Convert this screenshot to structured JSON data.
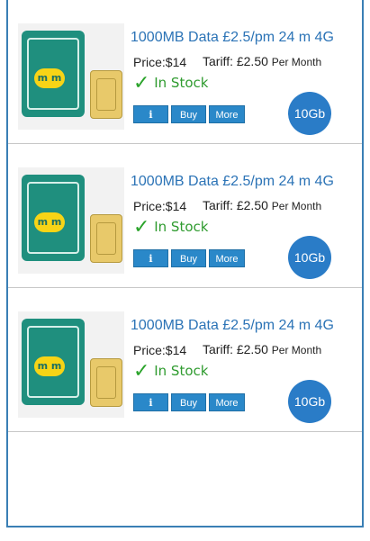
{
  "products": [
    {
      "title": "1000MB Data £2.5/pm 24 m 4G",
      "price": "Price:$14",
      "tariff_label": "Tariff: £2.50",
      "tariff_unit": "Per Month",
      "stock": "In Stock",
      "info_label": "i",
      "buy_label": "Buy",
      "more_label": "More",
      "badge": "10Gb",
      "logo_text": "m m"
    },
    {
      "title": "1000MB Data £2.5/pm 24 m 4G",
      "price": "Price:$14",
      "tariff_label": "Tariff: £2.50",
      "tariff_unit": "Per Month",
      "stock": "In Stock",
      "info_label": "i",
      "buy_label": "Buy",
      "more_label": "More",
      "badge": "10Gb",
      "logo_text": "m m"
    },
    {
      "title": "1000MB Data £2.5/pm 24 m 4G",
      "price": "Price:$14",
      "tariff_label": "Tariff: £2.50",
      "tariff_unit": "Per Month",
      "stock": "In Stock",
      "info_label": "i",
      "buy_label": "Buy",
      "more_label": "More",
      "badge": "10Gb",
      "logo_text": "m m"
    }
  ],
  "icons": {
    "stock": "check-icon",
    "info": "info-icon"
  },
  "colors": {
    "accent": "#2a88c9",
    "title": "#2b73b6",
    "stock": "#2f9b2f",
    "badge": "#2a7cc7",
    "frame": "#3a7fb5"
  }
}
